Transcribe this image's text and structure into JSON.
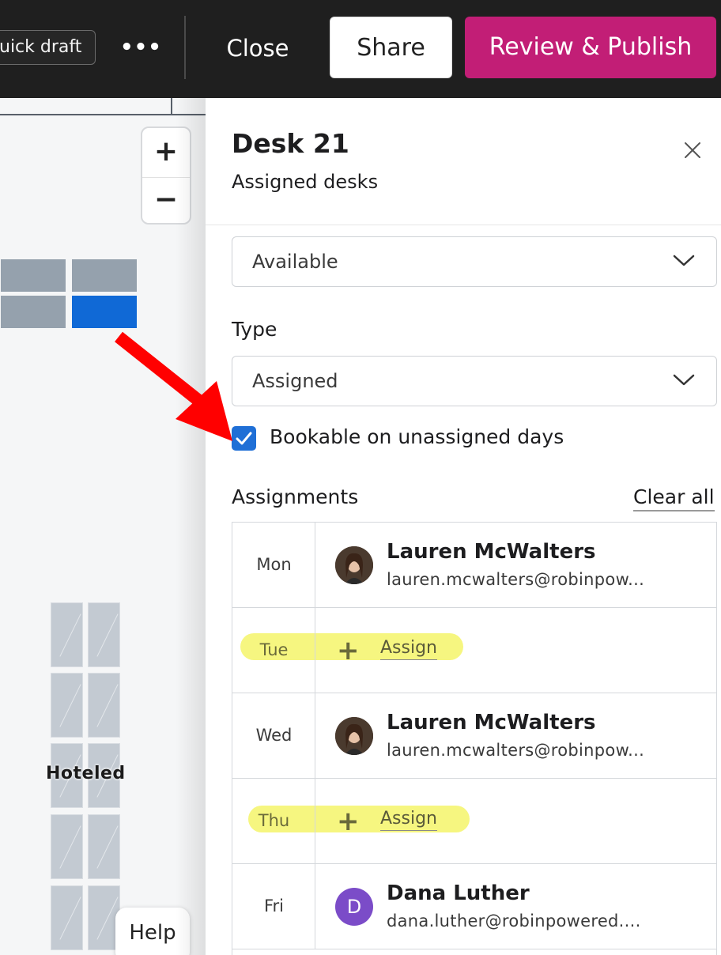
{
  "topbar": {
    "draft_label": "uick draft",
    "more_label": "•••",
    "close_label": "Close",
    "share_label": "Share",
    "publish_label": "Review & Publish"
  },
  "map": {
    "zoom_in_label": "+",
    "zoom_out_label": "−",
    "hoteled_label": "Hoteled",
    "help_label": "Help"
  },
  "panel": {
    "title": "Desk 21",
    "subtitle": "Assigned desks",
    "status_value": "Available",
    "type_label": "Type",
    "type_value": "Assigned",
    "bookable_label": "Bookable on unassigned days",
    "bookable_checked": true,
    "assignments_title": "Assignments",
    "clear_all_label": "Clear all",
    "assignments": [
      {
        "day": "Mon",
        "name": "Lauren McWalters",
        "email": "lauren.mcwalters@robinpow..."
      },
      {
        "day": "Tue",
        "assign_label": "Assign"
      },
      {
        "day": "Wed",
        "name": "Lauren McWalters",
        "email": "lauren.mcwalters@robinpow..."
      },
      {
        "day": "Thu",
        "assign_label": "Assign"
      },
      {
        "day": "Fri",
        "name": "Dana Luther",
        "email": "dana.luther@robinpowered....",
        "initial": "D"
      }
    ]
  },
  "colors": {
    "publish": "#c21e76",
    "checkbox": "#1f6fd6",
    "selected_desk": "#1069d6",
    "highlight": "#f4f56a",
    "arrow": "#ff0000"
  }
}
